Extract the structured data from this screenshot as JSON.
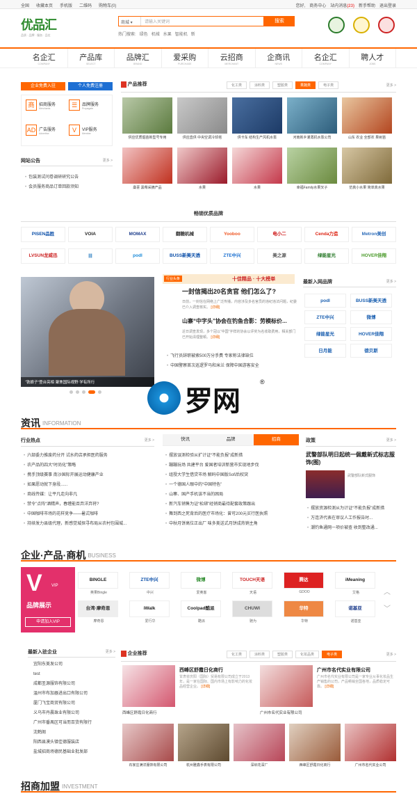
{
  "topbar": {
    "left": [
      "全国",
      "收藏本页",
      "手机版",
      "二维码",
      "购物车(0)"
    ],
    "right": [
      "您好,",
      "商务中心",
      "站内消息",
      "(23)",
      "新手帮助",
      "退出登录"
    ]
  },
  "logo": {
    "name": "优品汇",
    "slogan": "品质 · 品牌 · 服务 · 品位"
  },
  "search": {
    "category": "商城",
    "placeholder": "请输入关键词",
    "button": "搜索",
    "hot_label": "热门搜索:",
    "hot": [
      "绿色",
      "机械",
      "水果",
      "智能机",
      "新"
    ]
  },
  "nav": [
    {
      "zh": "名企汇",
      "en": "COMPANY"
    },
    {
      "zh": "产品库",
      "en": "SELECT"
    },
    {
      "zh": "品牌汇",
      "en": "BRAND"
    },
    {
      "zh": "爱采购",
      "en": "PURCHASE"
    },
    {
      "zh": "云招商",
      "en": "MERCHANT"
    },
    {
      "zh": "企商讯",
      "en": "NEWS"
    },
    {
      "zh": "名企汇",
      "en": "COMPANY"
    },
    {
      "zh": "聘人才",
      "en": "JOBS"
    }
  ],
  "reg": {
    "company": "企业免费入驻",
    "person": "个人免费注册"
  },
  "services": [
    {
      "icon": "商",
      "name": "招商服务",
      "en": "Merchants"
    },
    {
      "icon": "☰",
      "name": "品牌服务",
      "en": "Propagate"
    },
    {
      "icon": "AD",
      "name": "广告服务",
      "en": "Advertise"
    },
    {
      "icon": "V",
      "name": "VIP服务",
      "en": "Member"
    }
  ],
  "notice": {
    "title": "网站公告",
    "more": "更多 >",
    "items": [
      "包装测试问卷调研研究公告",
      "会员服务商品订单回款须知"
    ]
  },
  "products": {
    "title": "产品推荐",
    "more": "更多 >",
    "tabs": [
      "化工类",
      "涂料类",
      "塑胶类",
      "果蔬类",
      "电子类"
    ],
    "active": 3,
    "items": [
      "供应优质烟苗新型号专用",
      "供应直供 中央空调冷却塔",
      "供卡车 结构生产风机水泵",
      "河南新乡灌溉机水泵公司",
      "山东 农业 全部农 果树苗",
      "桑葚 黑莓采摘产品",
      "水果",
      "水果",
      "幸福Family水果叉子",
      "仿真小水果 简单真水果"
    ]
  },
  "hot_brands": {
    "title": "畅销优质品牌",
    "row1": [
      "PISEN品胜",
      "VOIA",
      "MOMAX",
      "翻糖机械",
      "Yooboo",
      "电小二",
      "Cenda力造",
      "Metron美创"
    ],
    "row2": [
      "LVSUN龙威迅",
      "|||",
      "podl",
      "BUSS新美天透",
      "ZTE中兴",
      "美之源",
      "绿能星光",
      "HOVER佳翔"
    ]
  },
  "slider": {
    "caption": "“铁娘子”登台亮相 聚焦国际视野 学有所行"
  },
  "headline": {
    "tag": "行业头条",
    "title1": "一封信揭出20名贪官 他们怎么了?",
    "desc1": "日前，一封信在网络上广泛传播，内容涉及多名官员的违纪违法问题，纪委已介入调查核实。",
    "more1": "[详细]",
    "title2": "山寨“中字头”协会在钓鱼合影：劳模标价...",
    "desc2": "近日调查发现，多个冠以“中国”字样的协会以评奖为名收取费用，相关部门已开始清理整顿。",
    "more2": "[详细]",
    "list": [
      "飞行员辞职被索500万分手费 专家称法律缺位",
      "中国警察首次巡逻罗马和米兰 保障中国游客安全"
    ],
    "banner": "十佳精品 · 十大榜单"
  },
  "newbrands": {
    "title": "最新入网品牌",
    "more": "更多 >",
    "items": [
      "podl",
      "BUSS新美天透",
      "ZTE中兴",
      "微博",
      "绿能星光",
      "HOVER佳翔",
      "日月能",
      "德贝斯"
    ]
  },
  "watermark": {
    "text": "罗网",
    "reg": "®"
  },
  "info": {
    "title": "资讯",
    "en": "INFORMATION"
  },
  "industry": {
    "title": "行业热点",
    "more": "更多 >",
    "items": [
      "六部委力推废药分开 试水药店承担医药服务",
      "农产品的四大“时尚化”策略",
      "携手顶级赛事 南沙国际开展运动健康产业",
      "如果愿动就下身段......",
      "商线传媒：让平凡走向非凡",
      "禁令”点阵“酒精声，春缠能否弃洋弃将?",
      "中国咖啡市场的花样竞争——暑式咖啡",
      "持续发力县级代理，新感觉城探寻布局从农村包围城..."
    ]
  },
  "newstabs": {
    "tabs": [
      "快讯",
      "品牌",
      "招商"
    ],
    "active": 2,
    "items": [
      "摆放误测检验从扩计证“不能负报”成新措",
      "蹦蹦玩场 共建平台 爱国者培训新营市实现地步伐",
      "组授大学生借贷市场 解码中国版Sofi后权突",
      "一个德国人眼中的“中国特色”",
      "山寨、国产手机该不当的困局",
      "新汽车销售为证“松绑”经销商最待配套政策跟出",
      "舞到西之死背后的医疗市场化：曾可200元买行医执照",
      "中秋月饼高位正出厂 味多美送式月饼成热销主角"
    ]
  },
  "policy": {
    "title": "政策",
    "more": "更多 >",
    "headline": "武警部队明日起统一佩戴新式标志服饰(图)",
    "img_caption": "武警部队新式服饰",
    "items": [
      "摆放资源检测从为计证“不能负报”成新措",
      "万连济代表在审议人工作报告时...",
      "潮钓鱼通网一项价被查 收到整改通..."
    ]
  },
  "business": {
    "title": "企业·产品·商机",
    "en": "BUSINESS"
  },
  "vip": {
    "big": "V",
    "label": "品牌展示",
    "sub": "VIP",
    "join": "申请加入VIP"
  },
  "vipbrands": [
    {
      "logo": "BINGLE",
      "cap": "英果Bingle"
    },
    {
      "logo": "ZTE中兴",
      "cap": "中兴"
    },
    {
      "logo": "微博",
      "cap": "爱奥客"
    },
    {
      "logo": "TOUCH天语",
      "cap": "天语"
    },
    {
      "logo": "腾达",
      "cap": "GDOO"
    },
    {
      "logo": "iMeaning",
      "cap": "艾格"
    },
    {
      "logo": "台湾·摩奇恩",
      "cap": "摩奇恩"
    },
    {
      "logo": "iWalk",
      "cap": "爱行华"
    },
    {
      "logo": "Coolpad酷派",
      "cap": "酷派"
    },
    {
      "logo": "CHUWI",
      "cap": "驰为"
    },
    {
      "logo": "华特",
      "cap": "华特"
    },
    {
      "logo": "诺基亚",
      "cap": "诺基亚"
    }
  ],
  "newent": {
    "title": "最新入驻企业",
    "more": "更多 >",
    "items": [
      "宜阳东美发公司",
      "test",
      "成都圣源服饰有限公司",
      "温州市布加器进出口有限公司",
      "厦门飞宝商贸有限公司",
      "义乌市丹晨珠业有限公司",
      "广州市番禺区可当而百货有限行",
      "沈鹤阁",
      "阳西县漠头镇佳德服装店",
      "盐城招商场德民基础业批发部"
    ]
  },
  "entrec": {
    "title": "企业推荐",
    "more": "更多 >",
    "tabs": [
      "化工类",
      "涂料类",
      "塑胶类",
      "化妆品类",
      "电子类"
    ],
    "active": 4,
    "c1": {
      "name": "西峰区舒霞日化商行",
      "desc": "甘肃省庆阳（国际）贸易有限公司成立于2013年，是一家在国际、国内市场上有影响力的化妆品经营企业。",
      "more": "[详细]",
      "cap": "西峰区舒霞日化商行"
    },
    "c2": {
      "name": "广州市名代实业有限公司",
      "desc": "广州市名代实业有限公司是一家专业从事化妆品生产销售的公司，产品畅销全国各地，品质稳定可靠。",
      "more": "[详细]",
      "cap": "广州市名代实业有限公司"
    },
    "row": [
      "石家庄满洋服饰有限公司",
      "杭州雅鑫手表有限公司",
      "深圳花深厂",
      "西峰区舒霞日化商行",
      "广州市名代实业公司"
    ]
  },
  "invest": {
    "title": "招商加盟",
    "en": "INVESTMENT"
  }
}
